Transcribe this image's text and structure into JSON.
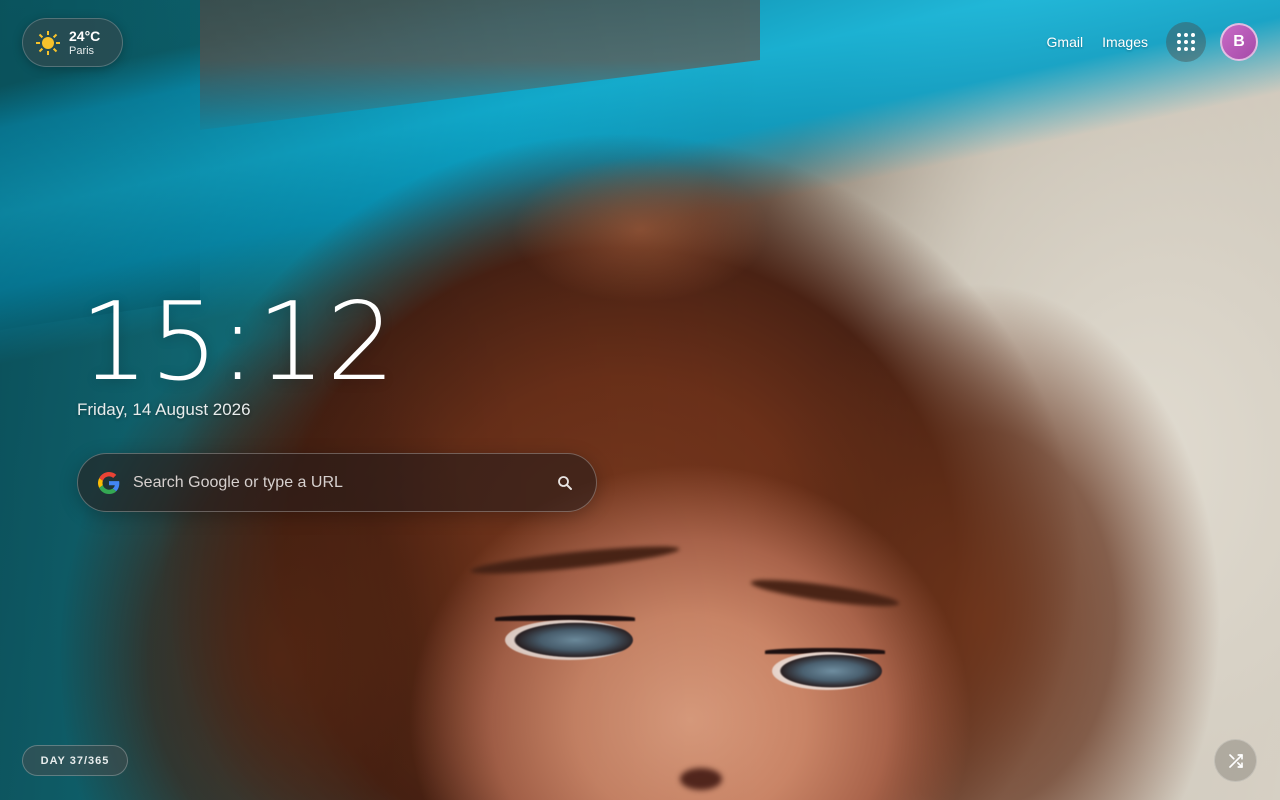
{
  "weather": {
    "icon": "sun-icon",
    "temperature": "24°C",
    "city": "Paris"
  },
  "header": {
    "links": [
      "Gmail",
      "Images"
    ],
    "apps_icon": "apps-grid-icon",
    "avatar_initial": "B",
    "avatar_color": "#b556b8"
  },
  "clock": {
    "time": "15:12",
    "date": "Friday, 14 August 2026"
  },
  "search": {
    "placeholder": "Search Google or type a URL",
    "value": "",
    "logo_icon": "google-g-icon",
    "button_icon": "search-icon"
  },
  "footer": {
    "day_badge": "DAY 37/365",
    "shuffle_icon": "shuffle-icon"
  }
}
